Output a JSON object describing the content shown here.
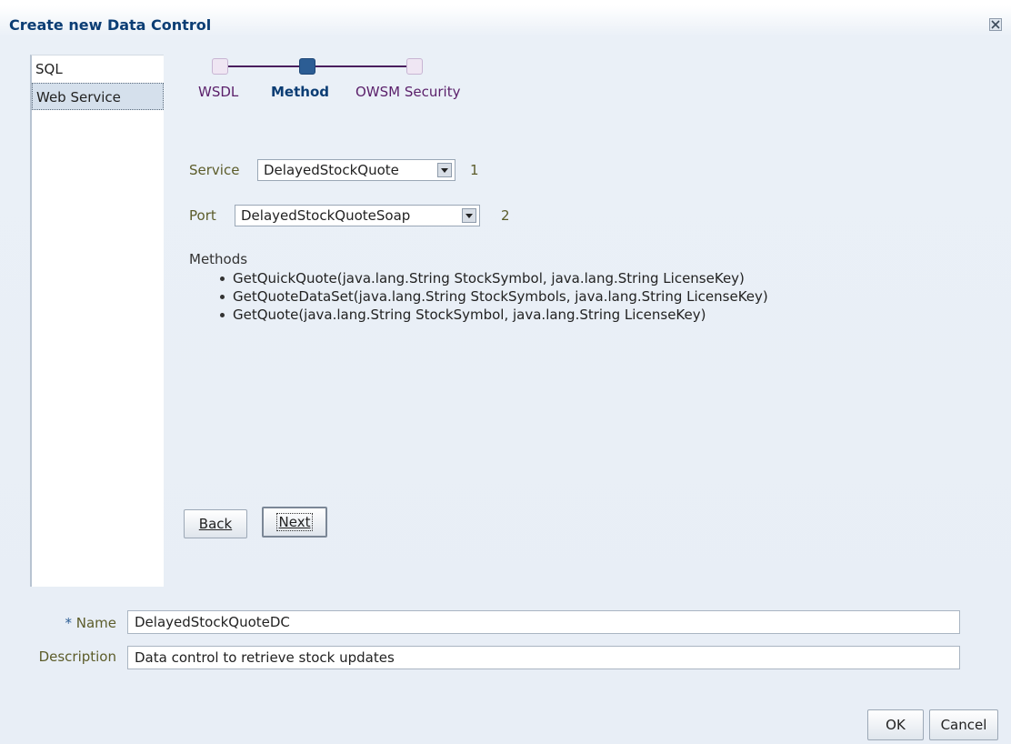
{
  "dialog": {
    "title": "Create new Data Control"
  },
  "sidebar": {
    "items": [
      {
        "label": "SQL",
        "selected": false
      },
      {
        "label": "Web Service",
        "selected": true
      }
    ]
  },
  "train": {
    "steps": [
      {
        "label": "WSDL",
        "state": "visited"
      },
      {
        "label": "Method",
        "state": "current"
      },
      {
        "label": "OWSM Security",
        "state": "unvisited"
      }
    ]
  },
  "form": {
    "service": {
      "label": "Service",
      "value": "DelayedStockQuote",
      "count": "1"
    },
    "port": {
      "label": "Port",
      "value": "DelayedStockQuoteSoap",
      "count": "2"
    },
    "methods_title": "Methods",
    "methods": [
      "GetQuickQuote(java.lang.String StockSymbol, java.lang.String LicenseKey)",
      "GetQuoteDataSet(java.lang.String StockSymbols, java.lang.String LicenseKey)",
      "GetQuote(java.lang.String StockSymbol, java.lang.String LicenseKey)"
    ],
    "back_label": "Back",
    "next_label": "Next"
  },
  "fields": {
    "name": {
      "required_mark": "*",
      "label": "Name",
      "value": "DelayedStockQuoteDC"
    },
    "description": {
      "label": "Description",
      "value": "Data control to retrieve stock updates"
    }
  },
  "footer": {
    "ok_label": "OK",
    "cancel_label": "Cancel"
  },
  "colors": {
    "title": "#0b3d74",
    "current_step": "#2c5d94",
    "visited_step": "#5a1f6a",
    "label_text": "#5c5c2a"
  }
}
